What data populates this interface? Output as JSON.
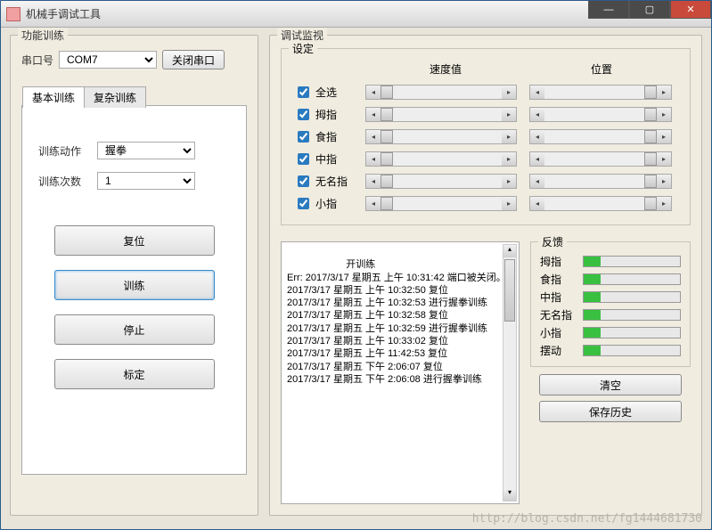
{
  "window": {
    "title": "机械手调试工具"
  },
  "left": {
    "group_title": "功能训练",
    "com_label": "串口号",
    "com_value": "COM7",
    "close_com": "关闭串口",
    "tabs": [
      "基本训练",
      "复杂训练"
    ],
    "action_label": "训练动作",
    "action_value": "握拳",
    "count_label": "训练次数",
    "count_value": "1",
    "btn_reset": "复位",
    "btn_train": "训练",
    "btn_stop": "停止",
    "btn_calib": "标定"
  },
  "right": {
    "group_title": "调试监视",
    "settings_title": "设定",
    "col_speed": "速度值",
    "col_pos": "位置",
    "rows": [
      {
        "label": "全选",
        "checked": true
      },
      {
        "label": "拇指",
        "checked": true
      },
      {
        "label": "食指",
        "checked": true
      },
      {
        "label": "中指",
        "checked": true
      },
      {
        "label": "无名指",
        "checked": true
      },
      {
        "label": "小指",
        "checked": true
      }
    ],
    "log": "开训练\nErr: 2017/3/17 星期五 上午 10:31:42 端口被关闭。\n2017/3/17 星期五 上午 10:32:50 复位\n2017/3/17 星期五 上午 10:32:53 进行握拳训练\n2017/3/17 星期五 上午 10:32:58 复位\n2017/3/17 星期五 上午 10:32:59 进行握拳训练\n2017/3/17 星期五 上午 10:33:02 复位\n2017/3/17 星期五 上午 11:42:53 复位\n2017/3/17 星期五 下午 2:06:07 复位\n2017/3/17 星期五 下午 2:06:08 进行握拳训练",
    "feedback_title": "反馈",
    "fb_rows": [
      "拇指",
      "食指",
      "中指",
      "无名指",
      "小指",
      "摆动"
    ],
    "btn_clear": "清空",
    "btn_save": "保存历史"
  },
  "watermark": "http://blog.csdn.net/fg1444681730"
}
